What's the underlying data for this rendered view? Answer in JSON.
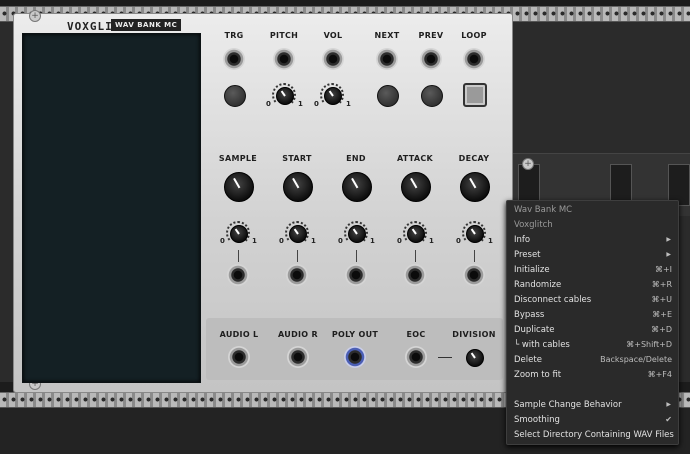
{
  "module": {
    "brand": "VOXGLITCH",
    "badge": "WAV BANK MC",
    "top_labels": [
      "TRG",
      "PITCH",
      "VOL",
      "NEXT",
      "PREV",
      "LOOP"
    ],
    "mid_labels": [
      "SAMPLE",
      "START",
      "END",
      "ATTACK",
      "DECAY"
    ],
    "range_min": "0",
    "range_max": "1",
    "output_labels": [
      "AUDIO L",
      "AUDIO R",
      "POLY OUT",
      "EOC",
      "DIVISION"
    ]
  },
  "context_menu": {
    "header_title": "Wav Bank MC",
    "header_author": "Voxglitch",
    "items": [
      {
        "label": "Info",
        "shortcut": "",
        "submenu": true
      },
      {
        "label": "Preset",
        "shortcut": "",
        "submenu": true
      },
      {
        "label": "Initialize",
        "shortcut": "⌘+I"
      },
      {
        "label": "Randomize",
        "shortcut": "⌘+R"
      },
      {
        "label": "Disconnect cables",
        "shortcut": "⌘+U"
      },
      {
        "label": "Bypass",
        "shortcut": "⌘+E"
      },
      {
        "label": "Duplicate",
        "shortcut": "⌘+D"
      },
      {
        "label": "└ with cables",
        "shortcut": "⌘+Shift+D"
      },
      {
        "label": "Delete",
        "shortcut": "Backspace/Delete"
      },
      {
        "label": "Zoom to fit",
        "shortcut": "⌘+F4"
      }
    ],
    "extra_items": [
      {
        "label": "Sample Change Behavior",
        "shortcut": "",
        "submenu": true
      },
      {
        "label": "Smoothing",
        "shortcut": "✔"
      },
      {
        "label": "Select Directory Containing WAV Files",
        "shortcut": ""
      }
    ]
  }
}
